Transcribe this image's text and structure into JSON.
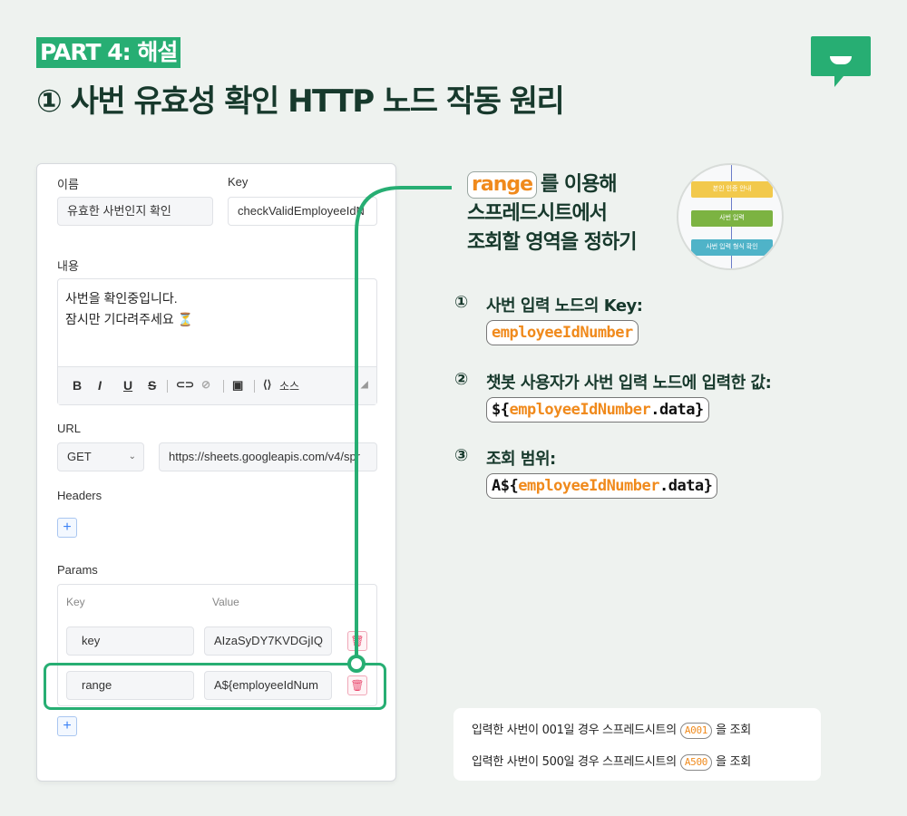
{
  "header": {
    "part_label": "PART 4: 해설",
    "title": "① 사번 유효성 확인  HTTP 노드 작동 원리"
  },
  "form": {
    "name_label": "이름",
    "name_value": "유효한 사번인지 확인",
    "key_label": "Key",
    "key_value": "checkValidEmployeeIdN",
    "content_label": "내용",
    "content_lines": [
      "사번을 확인중입니다.",
      "잠시만 기다려주세요 ⏳"
    ],
    "toolbar": {
      "bold": "B",
      "italic": "I",
      "underline": "U",
      "strike": "S",
      "source": "소스"
    },
    "url_label": "URL",
    "method": "GET",
    "url_value": "https://sheets.googleapis.com/v4/spr",
    "headers_label": "Headers",
    "params_label": "Params",
    "params_key_header": "Key",
    "params_value_header": "Value",
    "params": [
      {
        "key": "key",
        "value": "AIzaSyDY7KVDGjIQ"
      },
      {
        "key": "range",
        "value": "A${employeeIdNum"
      }
    ],
    "plus": "+"
  },
  "explain": {
    "range_chip": "range",
    "heading_rest": "를 이용해",
    "heading_line2": "스프레드시트에서",
    "heading_line3": "조회할 영역을 정하기",
    "thumb_blocks": [
      "본인 인증 안내",
      "사번 입력",
      "사번 입력 형식 확인"
    ],
    "steps": [
      {
        "num": "①",
        "label": "사번 입력 노드의 Key:",
        "code_pre": "",
        "code_orange": "employeeIdNumber",
        "code_post": ""
      },
      {
        "num": "②",
        "label": "챗봇 사용자가 사번 입력 노드에 입력한 값:",
        "code_pre": "${",
        "code_orange": "employeeIdNumber",
        "code_post": ".data}"
      },
      {
        "num": "③",
        "label": "조회 범위:",
        "code_pre": "A${",
        "code_orange": "employeeIdNumber",
        "code_post": ".data}"
      }
    ],
    "notes": [
      {
        "pre": "입력한 사번이 001일 경우 스프레드시트의",
        "chip": "A001",
        "post": "을 조회"
      },
      {
        "pre": "입력한 사번이 500일 경우 스프레드시트의",
        "chip": "A500",
        "post": "을 조회"
      }
    ]
  },
  "colors": {
    "accent": "#27ae73",
    "orange": "#f08a1c",
    "background": "#eef2ef"
  }
}
